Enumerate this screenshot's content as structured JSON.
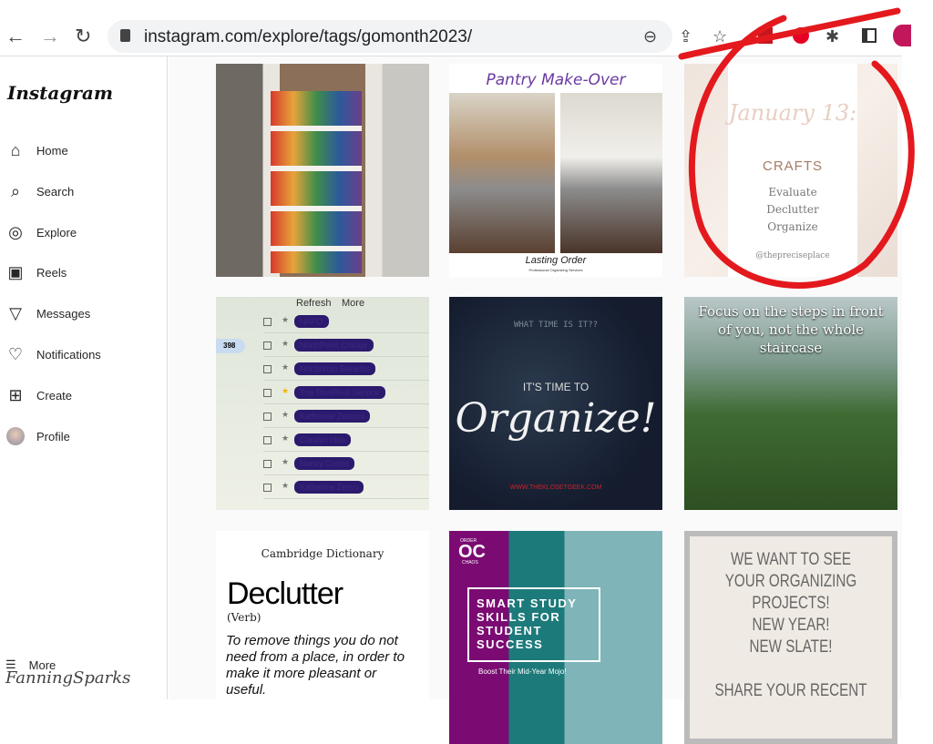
{
  "browser": {
    "url": "instagram.com/explore/tags/gomonth2023/",
    "icons": [
      "back-icon",
      "forward-icon",
      "reload-icon",
      "zoom-icon",
      "share-icon",
      "bookmark-star-icon",
      "acrobat-icon",
      "pinterest-icon",
      "extensions-icon",
      "side-panel-icon",
      "profile-icon"
    ]
  },
  "sidebar": {
    "logo": "Instagram",
    "items": [
      {
        "label": "Home",
        "icon": "⌂"
      },
      {
        "label": "Search",
        "icon": "⌕"
      },
      {
        "label": "Explore",
        "icon": "◎"
      },
      {
        "label": "Reels",
        "icon": "▣"
      },
      {
        "label": "Messages",
        "icon": "▽"
      },
      {
        "label": "Notifications",
        "icon": "♡"
      },
      {
        "label": "Create",
        "icon": "⊞"
      },
      {
        "label": "Profile",
        "icon": ""
      }
    ],
    "more": "More",
    "more_icon": "☰"
  },
  "posts": {
    "pantry": {
      "title": "Pantry Make-Over",
      "brand": "Lasting Order",
      "brand_sub": "Professional Organizing Services"
    },
    "crafts": {
      "date": "January 13:",
      "title": "CRAFTS",
      "lines": [
        "Evaluate",
        "Declutter",
        "Organize"
      ],
      "handle": "@thepreciseplace"
    },
    "email": {
      "toolbar": [
        "Refresh",
        "More"
      ],
      "count": "398",
      "senders": [
        "NAPO",
        "NorthPoint Chiropr",
        "Nordstrom Benefits",
        "The RealReal Service",
        "Katherine Zercuni",
        "Carolyn Hon",
        "Nancy Castel",
        "Katherine Zercu"
      ]
    },
    "organize": {
      "question": "WHAT TIME IS IT??",
      "lead": "IT'S TIME TO",
      "main": "Organize!",
      "site": "WWW.THEKLOSETGEEK.COM"
    },
    "stairs": {
      "quote": "Focus on the steps in front of you, not the whole staircase"
    },
    "dictionary": {
      "source": "Cambridge Dictionary",
      "word": "Declutter",
      "pos": "(Verb)",
      "definition": "To remove things you do not need from a place, in order to make it more pleasant or useful."
    },
    "study": {
      "logo": "OC",
      "logo_top": "ORDER",
      "logo_bottom": "CHAOS",
      "title": "SMART STUDY SKILLS FOR STUDENT SUCCESS",
      "sub": "Boost Their Mid-Year Mojo!"
    },
    "projects": {
      "lines": [
        "WE WANT TO SEE YOUR ORGANIZING PROJECTS!",
        "NEW YEAR! NEW SLATE!",
        "SHARE YOUR RECENT"
      ]
    }
  },
  "watermark": "FanningSparks",
  "colors": {
    "annotation": "#e3191e",
    "instagram_text": "#262626"
  }
}
